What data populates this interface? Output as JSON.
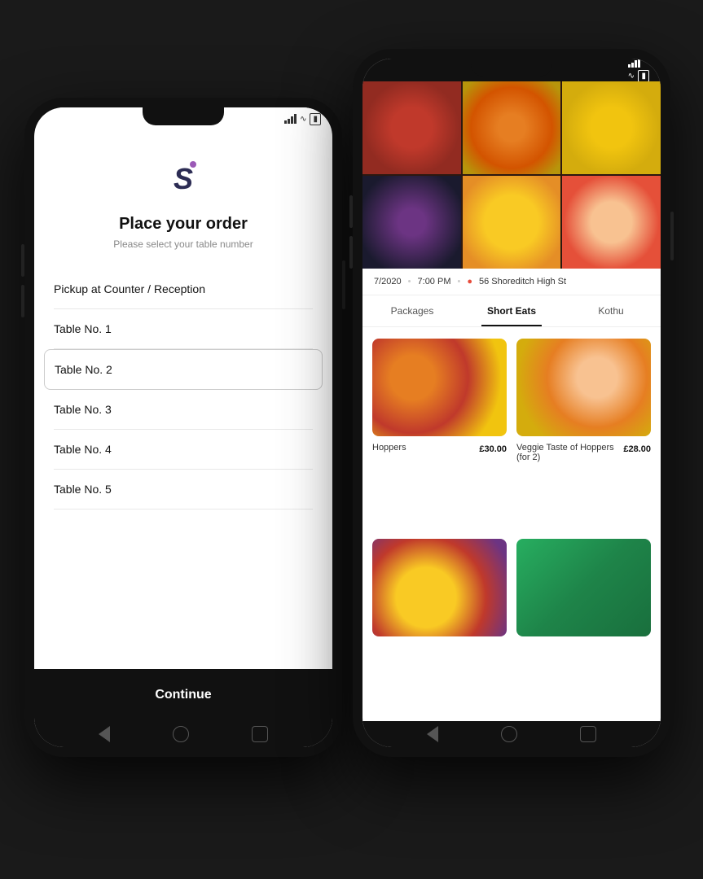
{
  "phone1": {
    "title": "Place your order",
    "subtitle": "Please select your table number",
    "logo_letter": "S",
    "items": [
      {
        "label": "Pickup at Counter / Reception",
        "selected": false
      },
      {
        "label": "Table No. 1",
        "selected": false
      },
      {
        "label": "Table No. 2",
        "selected": true
      },
      {
        "label": "Table No. 3",
        "selected": false
      },
      {
        "label": "Table No. 4",
        "selected": false
      },
      {
        "label": "Table No. 5",
        "selected": false
      }
    ],
    "continue_label": "Continue"
  },
  "phone2": {
    "date": "7/2020",
    "time": "7:00 PM",
    "location": "56 Shoreditch High St",
    "tabs": [
      {
        "label": "Packages",
        "active": false
      },
      {
        "label": "Short Eats",
        "active": true
      },
      {
        "label": "Kothu",
        "active": false
      }
    ],
    "menu_items": [
      {
        "name": "Hoppers",
        "price": "£30.00",
        "side": "left"
      },
      {
        "name": "Veggie Taste of Hoppers (for 2)",
        "price": "£28.00",
        "side": "right"
      },
      {
        "name": "",
        "price": "",
        "side": "left-bottom"
      },
      {
        "name": "",
        "price": "",
        "side": "right-bottom"
      }
    ]
  }
}
